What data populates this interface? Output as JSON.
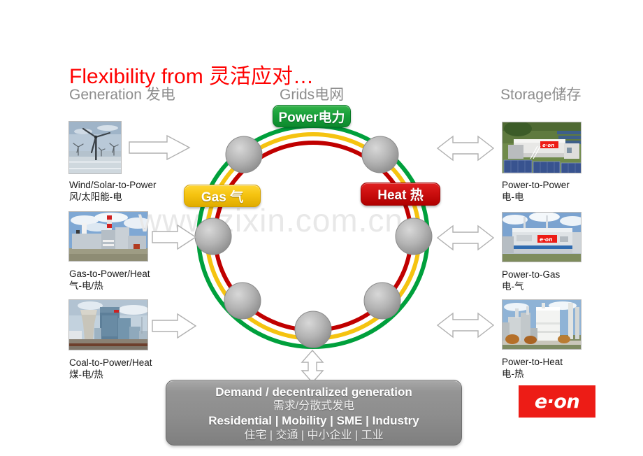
{
  "title": "Flexibility from 灵活应对…",
  "columns": {
    "generation": "Generation 发电",
    "grids": "Grids电网",
    "storage": "Storage储存"
  },
  "watermark": "www.zixin.com.cn",
  "rings": {
    "power": {
      "label": "Power电力",
      "color": "#18a03a"
    },
    "gas": {
      "label": "Gas 气",
      "color": "#f5c310"
    },
    "heat": {
      "label": "Heat 热",
      "color": "#cc0f0f"
    }
  },
  "generation_items": [
    {
      "en": "Wind/Solar-to-Power",
      "cn": "风/太阳能-电",
      "image": "offshore-wind-farm-photo",
      "arrow": "right-arrow"
    },
    {
      "en": "Gas-to-Power/Heat",
      "cn": "气-电/热",
      "image": "gas-power-plant-photo",
      "arrow": "right-arrow"
    },
    {
      "en": "Coal-to-Power/Heat",
      "cn": "煤-电/热",
      "image": "coal-power-plant-photo",
      "arrow": "right-arrow"
    }
  ],
  "storage_items": [
    {
      "en": "Power-to-Power",
      "cn": "电-电",
      "image": "battery-storage-container-photo",
      "arrow": "double-arrow"
    },
    {
      "en": "Power-to-Gas",
      "cn": "电-气",
      "image": "power-to-gas-unit-photo",
      "arrow": "double-arrow"
    },
    {
      "en": "Power-to-Heat",
      "cn": "电-热",
      "image": "heat-storage-plant-photo",
      "arrow": "double-arrow"
    }
  ],
  "demand": {
    "line1": "Demand / decentralized generation",
    "line2": "需求/分散式发电",
    "line3": "Residential | Mobility | SME |  Industry",
    "line4": "住宅 | 交通 | 中小企业 | 工业",
    "arrow": "down-up-arrow"
  },
  "logo": {
    "text": "e·on",
    "background": "#ED1C16"
  }
}
